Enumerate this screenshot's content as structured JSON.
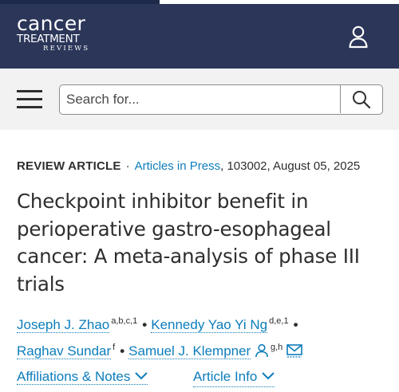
{
  "header": {
    "logo_line1": "cancer",
    "logo_line2": "TREATMENT",
    "logo_line3": "REVIEWS",
    "user_icon": "user-icon"
  },
  "search": {
    "placeholder": "Search for...",
    "menu_icon": "hamburger-menu-icon",
    "search_icon": "magnifier-icon"
  },
  "article": {
    "type": "REVIEW ARTICLE",
    "separator": "·",
    "status_link": "Articles in Press",
    "citation": ", 103002, August 05, 2025",
    "title": "Checkpoint inhibitor benefit in perioperative gastro-esophageal cancer: A meta-analysis of phase III trials",
    "authors": [
      {
        "name": "Joseph J. Zhao",
        "affiliations": "a,b,c,1"
      },
      {
        "name": "Kennedy Yao Yi Ng",
        "affiliations": "d,e,1"
      },
      {
        "name": "Raghav Sundar",
        "affiliations": "f"
      },
      {
        "name": "Samuel J. Klempner",
        "affiliations": "g,h"
      }
    ],
    "author_separator": "•"
  },
  "links": {
    "affiliations": "Affiliations & Notes",
    "article_info": "Article Info"
  },
  "colors": {
    "header_bg": "#2b3659",
    "link": "#0c7dbb",
    "search_bg": "#f2f2f2"
  }
}
